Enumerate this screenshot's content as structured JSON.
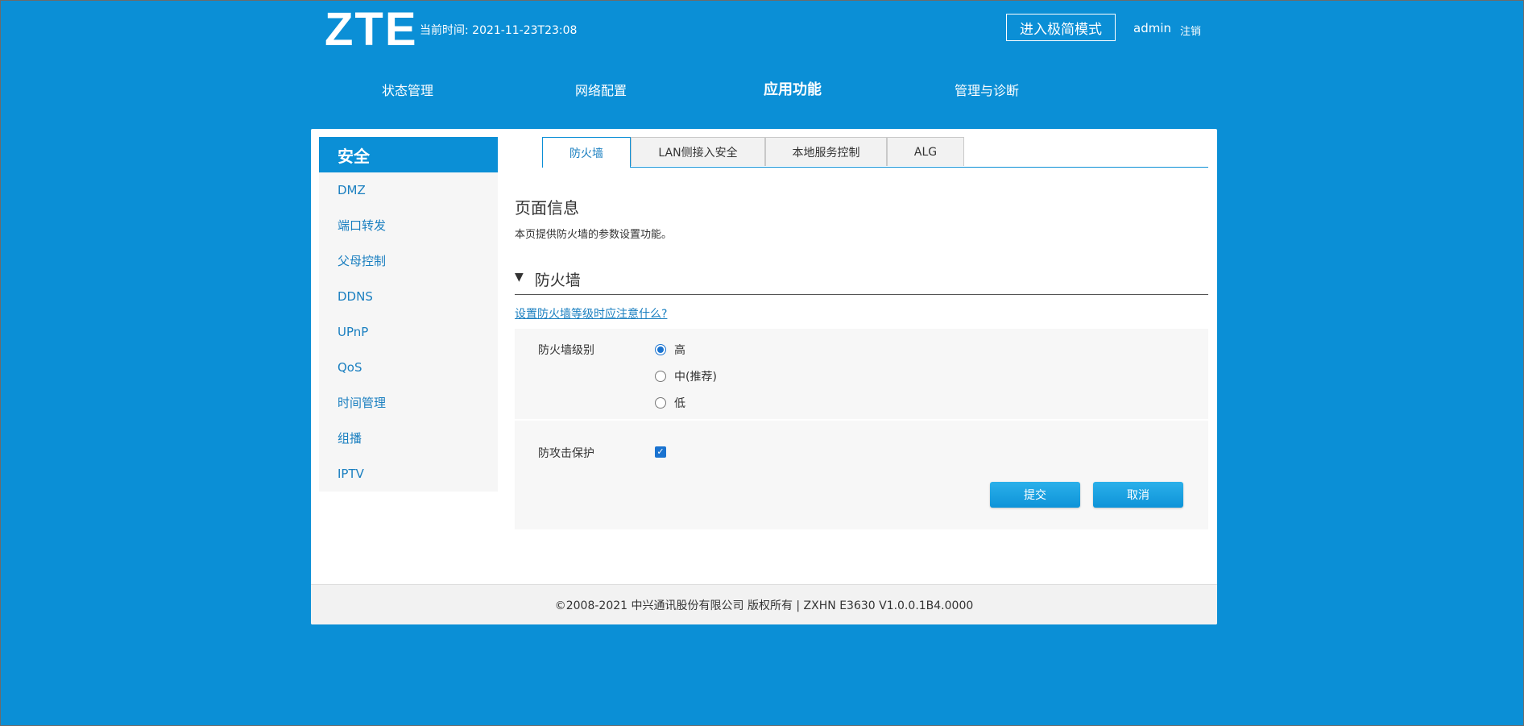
{
  "header": {
    "logo": "ZTE",
    "current_time_label": "当前时间:",
    "current_time_value": "2021-11-23T23:08",
    "simple_mode_label": "进入极简模式",
    "user": "admin",
    "logout": "注销"
  },
  "main_nav": [
    {
      "label": "状态管理",
      "active": false
    },
    {
      "label": "网络配置",
      "active": false
    },
    {
      "label": "应用功能",
      "active": true
    },
    {
      "label": "管理与诊断",
      "active": false
    }
  ],
  "sidebar": {
    "title": "安全",
    "items": [
      {
        "label": "DMZ"
      },
      {
        "label": "端口转发"
      },
      {
        "label": "父母控制"
      },
      {
        "label": "DDNS"
      },
      {
        "label": "UPnP"
      },
      {
        "label": "QoS"
      },
      {
        "label": "时间管理"
      },
      {
        "label": "组播"
      },
      {
        "label": "IPTV"
      }
    ]
  },
  "tabs": [
    {
      "label": "防火墙",
      "active": true
    },
    {
      "label": "LAN侧接入安全",
      "active": false
    },
    {
      "label": "本地服务控制",
      "active": false
    },
    {
      "label": "ALG",
      "active": false
    }
  ],
  "page_info": {
    "title": "页面信息",
    "description": "本页提供防火墙的参数设置功能。"
  },
  "firewall": {
    "section_title": "防火墙",
    "help_link": "设置防火墙等级时应注意什么?",
    "level_label": "防火墙级别",
    "levels": [
      {
        "label": "高",
        "checked": true
      },
      {
        "label": "中(推荐)",
        "checked": false
      },
      {
        "label": "低",
        "checked": false
      }
    ],
    "attack_protection_label": "防攻击保护",
    "attack_protection_checked": true,
    "submit_label": "提交",
    "cancel_label": "取消"
  },
  "footer": {
    "text": "©2008-2021 中兴通讯股份有限公司 版权所有 |   ZXHN E3630 V1.0.0.1B4.0000"
  },
  "colors": {
    "brand_blue": "#0b8fd6",
    "link_blue": "#1a7fc0",
    "radio_blue": "#1a73d0"
  }
}
